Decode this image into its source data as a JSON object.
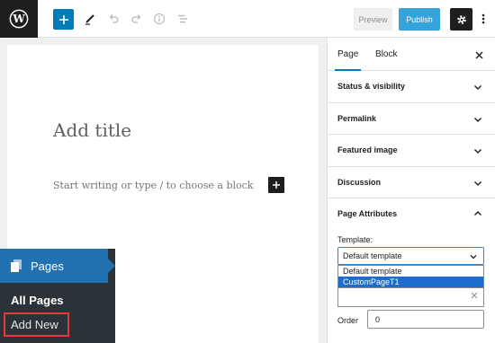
{
  "toolbar": {
    "preview_label": "Preview",
    "publish_label": "Publish"
  },
  "colors": {
    "accent": "#007cba",
    "publish": "#35a4dc",
    "admin_menu_bg": "#2c3338",
    "admin_active": "#2271b1",
    "highlight_box": "#e23a3a"
  },
  "editor": {
    "title_placeholder": "Add title",
    "body_placeholder": "Start writing or type / to choose a block"
  },
  "admin_menu": {
    "section_label": "Pages",
    "items": [
      {
        "label": "All Pages"
      },
      {
        "label": "Add New"
      }
    ]
  },
  "sidebar": {
    "tabs": [
      {
        "label": "Page"
      },
      {
        "label": "Block"
      }
    ],
    "panels": [
      {
        "label": "Status & visibility"
      },
      {
        "label": "Permalink"
      },
      {
        "label": "Featured image"
      },
      {
        "label": "Discussion"
      }
    ],
    "page_attributes": {
      "label": "Page Attributes",
      "template_label": "Template:",
      "template_selected": "Default template",
      "template_options": [
        "Default template",
        "CustomPageT1"
      ],
      "order_label": "Order",
      "order_value": "0"
    }
  }
}
